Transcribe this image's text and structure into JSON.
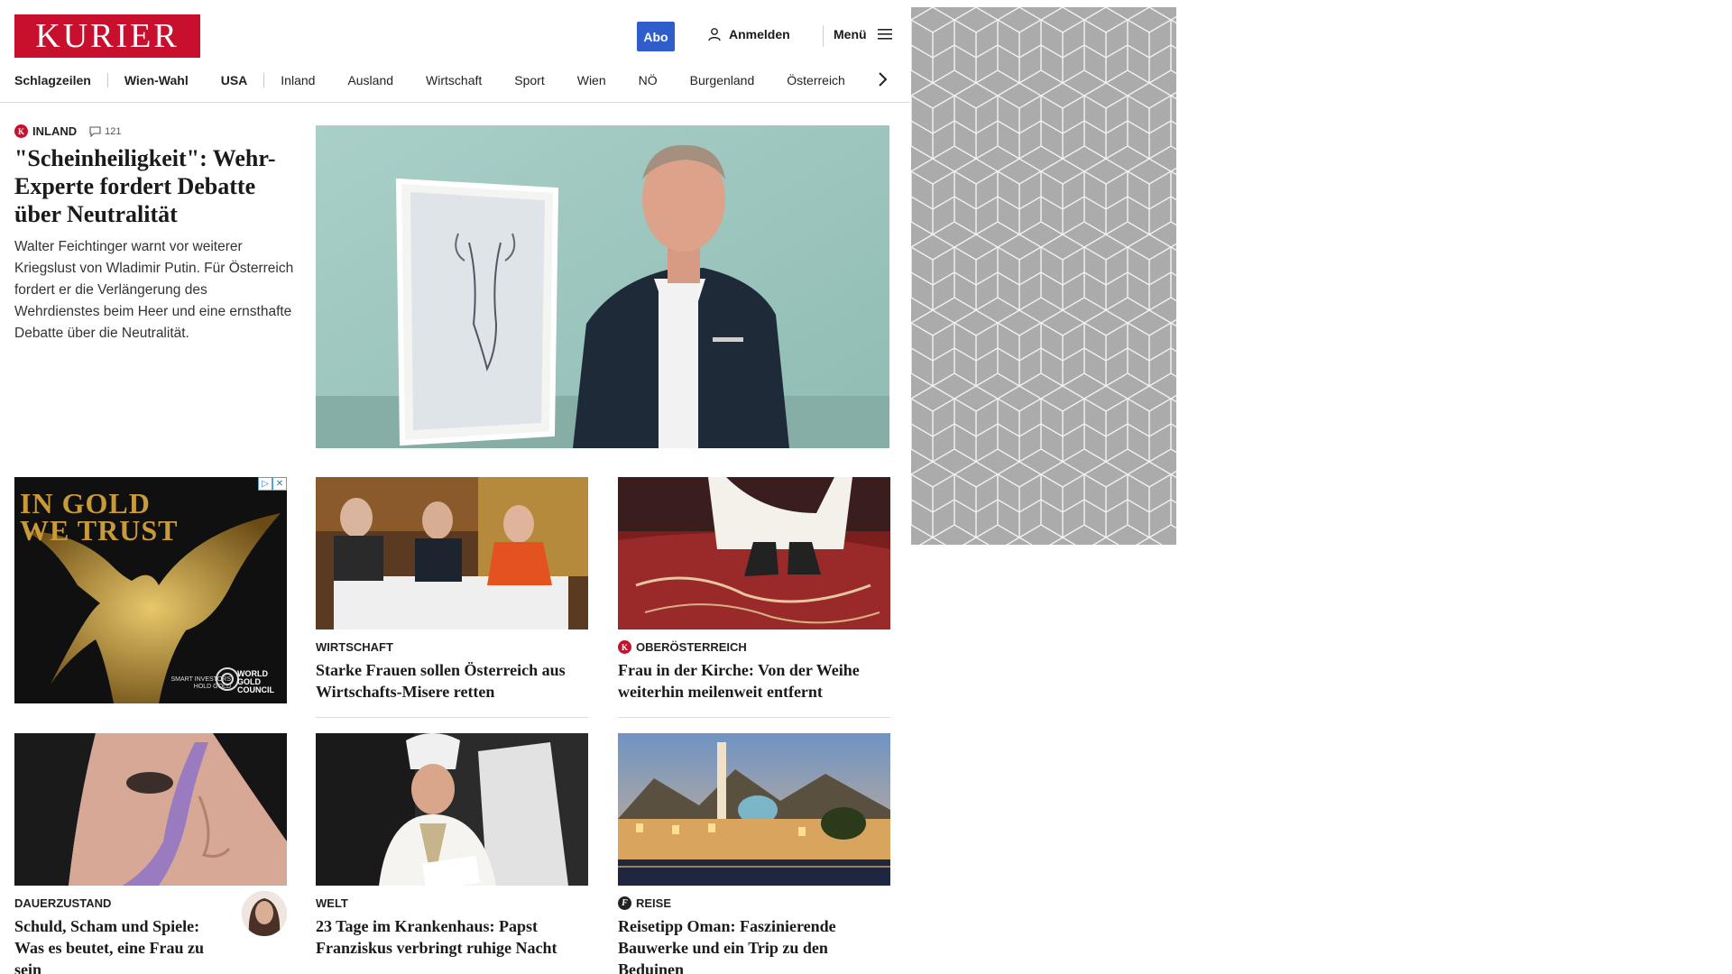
{
  "header": {
    "logo": "KURIER",
    "abo": "Abo",
    "login": "Anmelden",
    "menu": "Menü",
    "icons": {
      "login": "user-icon",
      "menu": "hamburger-icon",
      "next": "chevron-right-icon"
    }
  },
  "nav": {
    "items": [
      "Schlagzeilen",
      "Wien-Wahl",
      "USA",
      "Inland",
      "Ausland",
      "Wirtschaft",
      "Sport",
      "Wien",
      "NÖ",
      "Burgenland",
      "Österreich"
    ]
  },
  "lead": {
    "category": "INLAND",
    "comments": "121",
    "title": "\"Scheinheiligkeit\": Wehr-Experte fordert Debatte über Neutralität",
    "teaser": "Walter Feichtinger warnt vor weiterer Kriegslust von Wladimir Putin. Für Österreich fordert er die Verlängerung des Wehrdienstes beim Heer und eine ernsthafte Debatte über die Neutralität."
  },
  "ad": {
    "headline_1": "IN GOLD",
    "headline_2": "WE TRUST",
    "small_1": "SMART INVESTORS",
    "small_2": "HOLD GOLD",
    "brand_1": "WORLD",
    "brand_2": "GOLD",
    "brand_3": "COUNCIL"
  },
  "cards": [
    {
      "category": "WIRTSCHAFT",
      "title": "Starke Frauen sollen Österreich aus Wirtschafts-Misere retten"
    },
    {
      "category": "OBERÖSTERREICH",
      "title": "Frau in der Kirche: Von der Weihe weiterhin meilenweit entfernt"
    },
    {
      "category": "DAUERZUSTAND",
      "title": "Schuld, Scham und Spiele: Was es beutet, eine Frau zu sein"
    },
    {
      "category": "WELT",
      "title": "23 Tage im Krankenhaus: Papst Franziskus verbringt ruhige Nacht"
    },
    {
      "category": "REISE",
      "title": "Reisetipp Oman: Faszinierende Bauwerke und ein Trip zu den Beduinen"
    }
  ],
  "colors": {
    "brand": "#c8102e",
    "abo": "#2f5dcc",
    "pattern": "#ababab"
  }
}
